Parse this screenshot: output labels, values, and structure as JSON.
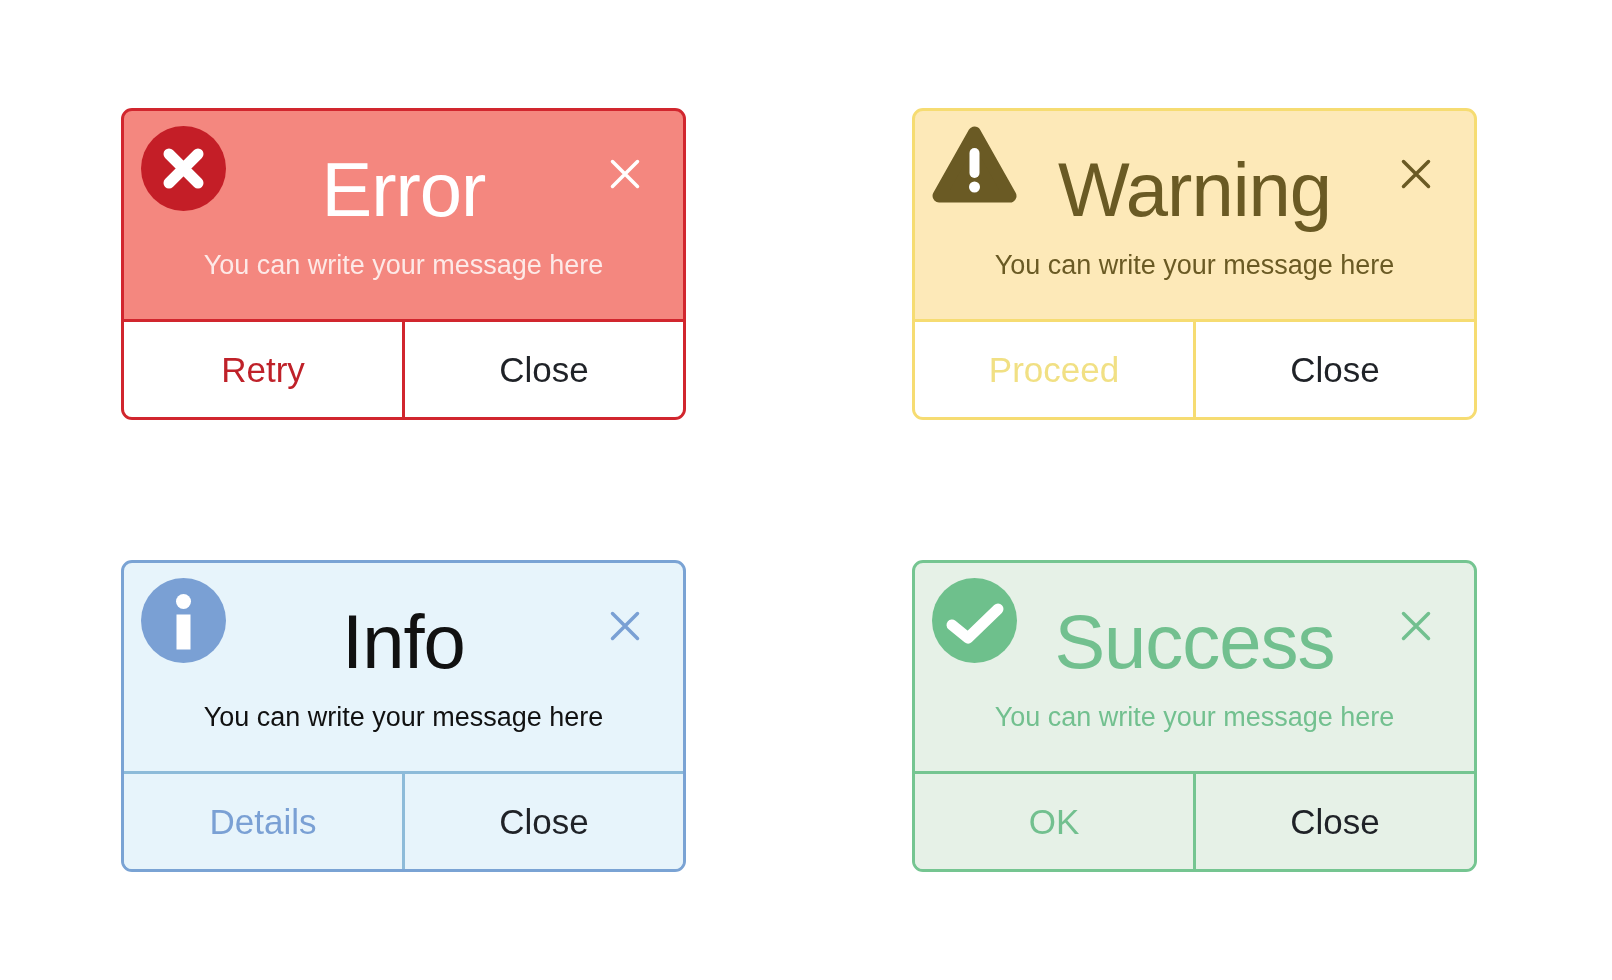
{
  "dialogs": [
    {
      "kind": "error",
      "title": "Error",
      "message": "You can write your message here",
      "buttons": [
        {
          "label": "Retry",
          "kind": "primary"
        },
        {
          "label": "Close",
          "kind": "secondary"
        }
      ]
    },
    {
      "kind": "warning",
      "title": "Warning",
      "message": "You can write your message here",
      "buttons": [
        {
          "label": "Proceed",
          "kind": "primary"
        },
        {
          "label": "Close",
          "kind": "secondary"
        }
      ]
    },
    {
      "kind": "info",
      "title": "Info",
      "message": "You can write your message here",
      "buttons": [
        {
          "label": "Details",
          "kind": "primary"
        },
        {
          "label": "Close",
          "kind": "secondary"
        }
      ]
    },
    {
      "kind": "success",
      "title": "Success",
      "message": "You can write your message here",
      "buttons": [
        {
          "label": "OK",
          "kind": "primary"
        },
        {
          "label": "Close",
          "kind": "secondary"
        }
      ]
    }
  ]
}
